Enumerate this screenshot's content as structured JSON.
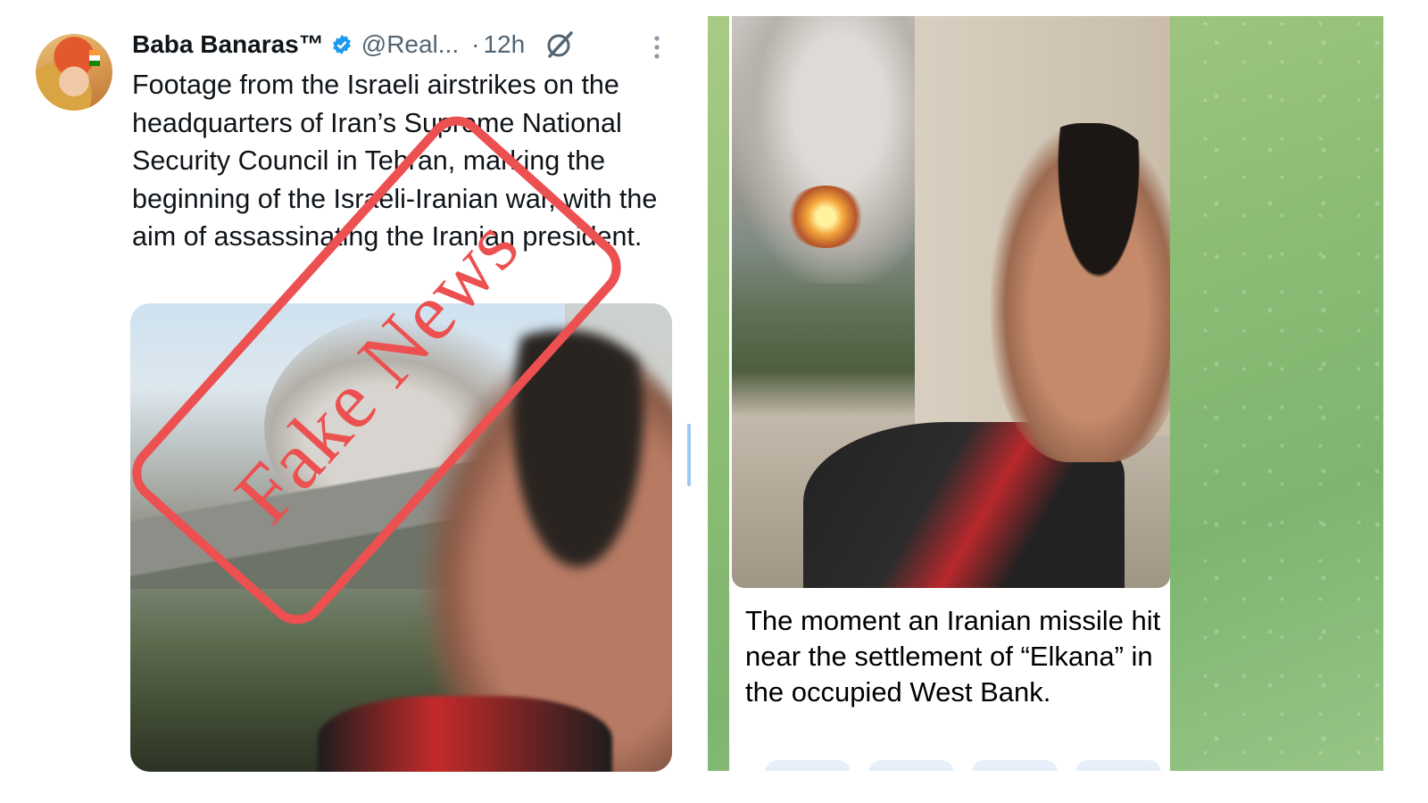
{
  "tweet": {
    "author_name": "Baba Banaras™",
    "handle": "@Real...",
    "separator": "·",
    "time": "12h",
    "text": "Footage from the Israeli airstrikes on the headquarters of Iran’s Supreme National Security Council in Tehran, marking the beginning of the Israeli-Iranian war, with the aim of assassinating the Iranian president.",
    "overlay_stamp": "Fake News",
    "icons": [
      "verified-badge-icon",
      "grok-icon",
      "more-options-icon"
    ],
    "colors": {
      "stamp": "#ec5050",
      "verified": "#1d9bf0",
      "secondary_text": "#536471"
    }
  },
  "telegram": {
    "caption": "The moment an Iranian missile hit near the settlement of “Elkana” in the occupied West Bank.",
    "colors": {
      "background": "#8dbd75"
    }
  }
}
